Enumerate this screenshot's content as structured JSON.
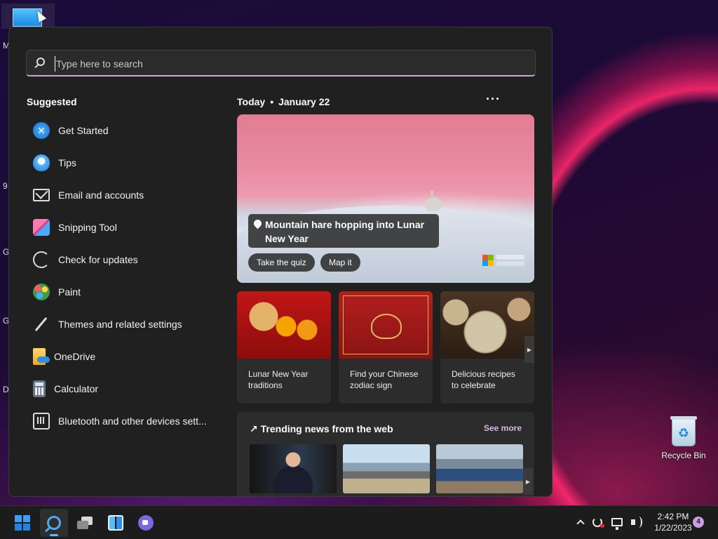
{
  "desktop": {
    "edge_chars": [
      "M",
      "9",
      "G",
      "G",
      "Da"
    ],
    "recycle_bin_label": "Recycle Bin"
  },
  "search": {
    "placeholder": "Type here to search",
    "value": ""
  },
  "suggested": {
    "title": "Suggested",
    "items": [
      {
        "label": "Get Started",
        "icon": "get-started-icon"
      },
      {
        "label": "Tips",
        "icon": "tips-lightbulb-icon"
      },
      {
        "label": "Email and accounts",
        "icon": "mail-icon"
      },
      {
        "label": "Snipping Tool",
        "icon": "snipping-tool-icon"
      },
      {
        "label": "Check for updates",
        "icon": "refresh-icon"
      },
      {
        "label": "Paint",
        "icon": "paint-palette-icon"
      },
      {
        "label": "Themes and related settings",
        "icon": "brush-icon"
      },
      {
        "label": "OneDrive",
        "icon": "onedrive-icon"
      },
      {
        "label": "Calculator",
        "icon": "calculator-icon"
      },
      {
        "label": "Bluetooth and other devices sett...",
        "icon": "bluetooth-devices-icon"
      }
    ]
  },
  "today": {
    "label": "Today",
    "separator": "•",
    "date": "January 22",
    "more_label": "···"
  },
  "hero": {
    "caption": "Mountain hare hopping into Lunar New Year",
    "quiz_button": "Take the quiz",
    "map_button": "Map it"
  },
  "cards": [
    {
      "title": "Lunar New Year traditions"
    },
    {
      "title": "Find your Chinese zodiac sign"
    },
    {
      "title": "Delicious recipes to celebrate"
    }
  ],
  "trending": {
    "title": "Trending news from the web",
    "see_more": "See more",
    "arrow_icon": "trending-up-icon"
  },
  "taskbar": {
    "time": "2:42 PM",
    "date": "1/22/2023",
    "notification_count": "4"
  },
  "colors": {
    "accent": "#c9a4d8",
    "panel_bg": "#202020",
    "taskbar_bg": "#1c1c1c",
    "see_more": "#d6b6e6"
  }
}
